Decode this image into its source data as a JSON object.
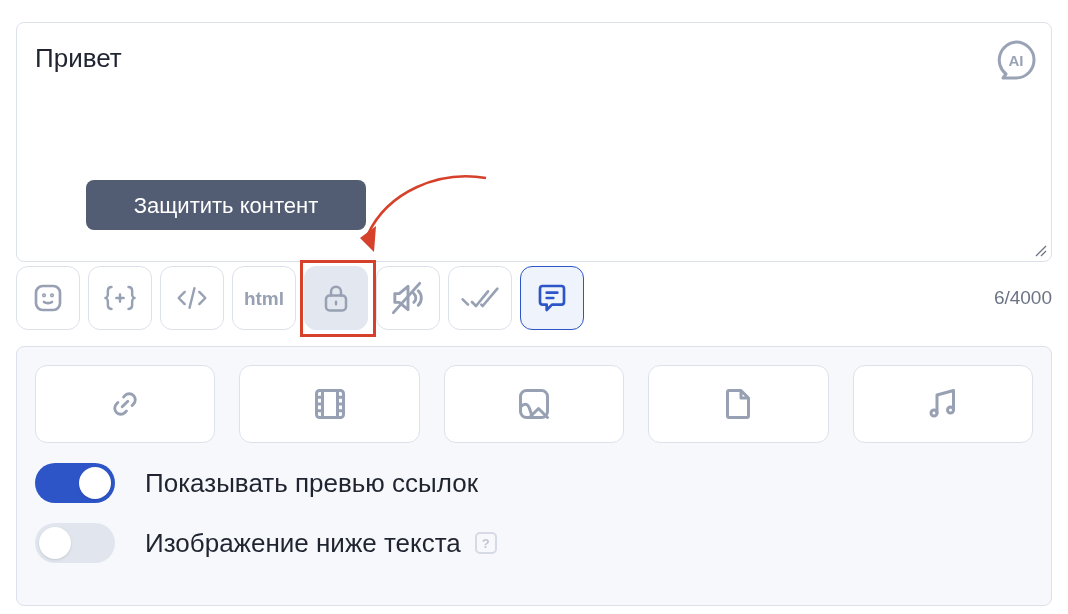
{
  "editor": {
    "value": "Привет",
    "ai_badge": "AI"
  },
  "tooltip": {
    "text": "Защитить контент"
  },
  "toolbar": [
    {
      "kind": "emoji",
      "selected": false,
      "hovered": false
    },
    {
      "kind": "variable",
      "selected": false,
      "hovered": false
    },
    {
      "kind": "code",
      "selected": false,
      "hovered": false
    },
    {
      "kind": "html",
      "label": "html",
      "selected": false,
      "hovered": false
    },
    {
      "kind": "lock",
      "selected": false,
      "hovered": true
    },
    {
      "kind": "sound-off",
      "selected": false,
      "hovered": false
    },
    {
      "kind": "double-check",
      "selected": false,
      "hovered": false
    },
    {
      "kind": "message",
      "selected": true,
      "hovered": false
    }
  ],
  "counter": "6/4000",
  "attachments": [
    {
      "kind": "link"
    },
    {
      "kind": "video"
    },
    {
      "kind": "image"
    },
    {
      "kind": "file"
    },
    {
      "kind": "audio"
    }
  ],
  "options": [
    {
      "label": "Показывать превью ссылок",
      "on": true
    },
    {
      "label": "Изображение ниже текста",
      "on": false,
      "help": "?"
    }
  ]
}
